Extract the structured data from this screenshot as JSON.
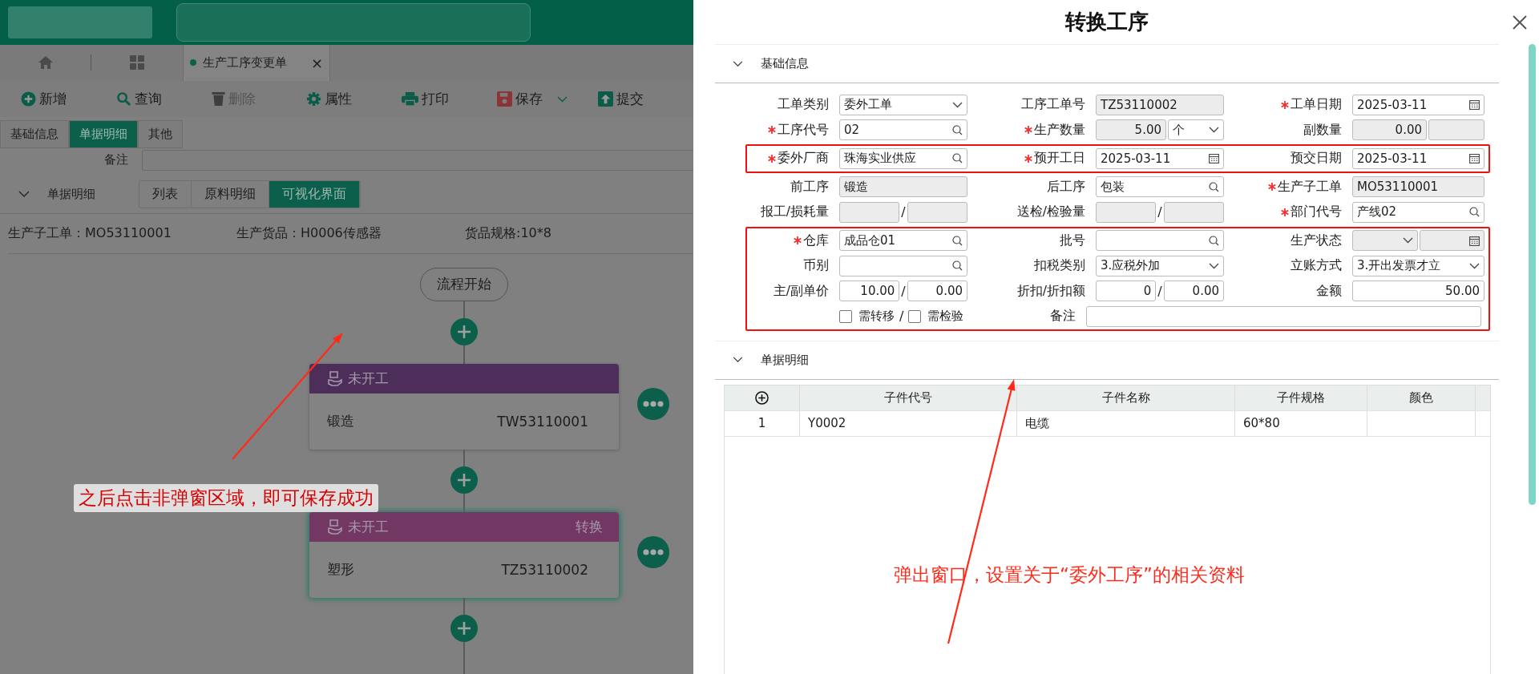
{
  "nav": {
    "tabs": [
      {
        "label": "生产工序变更单",
        "close": "×",
        "selected": true
      }
    ]
  },
  "toolbar": [
    {
      "kind": "add",
      "label": "新增",
      "disabled": false,
      "dropdown": false
    },
    {
      "kind": "search",
      "label": "查询",
      "disabled": false,
      "dropdown": false
    },
    {
      "kind": "delete",
      "label": "删除",
      "disabled": true,
      "dropdown": false
    },
    {
      "kind": "settings",
      "label": "属性",
      "disabled": false,
      "dropdown": false
    },
    {
      "kind": "print",
      "label": "打印",
      "disabled": false,
      "dropdown": false
    },
    {
      "kind": "save",
      "label": "保存",
      "disabled": false,
      "dropdown": true
    },
    {
      "kind": "submit",
      "label": "提交",
      "disabled": false,
      "dropdown": false
    }
  ],
  "form_tabs": [
    {
      "label": "基础信息",
      "selected": false
    },
    {
      "label": "单据明细",
      "selected": true
    },
    {
      "label": "其他",
      "selected": false
    }
  ],
  "remark": {
    "label": "备注"
  },
  "detail": {
    "title": "单据明细",
    "expanded": true,
    "views": [
      {
        "label": "列表",
        "selected": false
      },
      {
        "label": "原料明细",
        "selected": false
      },
      {
        "label": "可视化界面",
        "selected": true
      }
    ]
  },
  "info": [
    "生产子工单：MO53110001",
    "生产货品：H0006传感器",
    "货品规格:10*8"
  ],
  "flow": {
    "start": "流程开始",
    "nodes": [
      {
        "status": "未开工",
        "name": "锻造",
        "code": "TW53110001",
        "color": "#4d2d5a",
        "selected": false
      },
      {
        "status": "未开工",
        "action": "转换",
        "name": "塑形",
        "code": "TZ53110002",
        "color": "#733763",
        "selected": true
      }
    ]
  },
  "annotations": [
    "之后点击非弹窗区域，即可保存成功",
    "弹出窗口，设置关于“委外工序”的相关资料"
  ],
  "dialog": {
    "title": "转换工序",
    "basic": {
      "title": "基础信息",
      "expanded": true,
      "groups": [
        {
          "highlighted": false,
          "rows": [
            [
              {
                "label": "工单类别",
                "required": false,
                "kind": "single",
                "inputs": [
                  {
                    "kind": "select",
                    "value": "委外工单",
                    "readonly": false
                  }
                ]
              },
              {
                "label": "工序工单号",
                "required": false,
                "kind": "single",
                "inputs": [
                  {
                    "kind": "text",
                    "value": "TZ53110002",
                    "readonly": true
                  }
                ]
              },
              {
                "label": "工单日期",
                "required": true,
                "kind": "single",
                "inputs": [
                  {
                    "kind": "date",
                    "value": "2025-03-11",
                    "readonly": false
                  }
                ]
              }
            ],
            [
              {
                "label": "工序代号",
                "required": true,
                "kind": "single",
                "inputs": [
                  {
                    "kind": "lookup",
                    "value": "02",
                    "readonly": false
                  }
                ]
              },
              {
                "label": "生产数量",
                "required": true,
                "kind": "split",
                "inputs": [
                  {
                    "kind": "number",
                    "value": "5.00",
                    "readonly": true
                  },
                  {
                    "kind": "select",
                    "value": "个",
                    "readonly": false
                  }
                ]
              },
              {
                "label": "副数量",
                "required": false,
                "kind": "split",
                "inputs": [
                  {
                    "kind": "number",
                    "value": "0.00",
                    "readonly": true
                  },
                  {
                    "kind": "text",
                    "readonly": true
                  }
                ]
              }
            ]
          ]
        },
        {
          "highlighted": true,
          "rows": [
            [
              {
                "label": "委外厂商",
                "required": true,
                "kind": "single",
                "inputs": [
                  {
                    "kind": "lookup",
                    "value": "珠海实业供应",
                    "readonly": false
                  }
                ]
              },
              {
                "label": "预开工日",
                "required": true,
                "kind": "single",
                "inputs": [
                  {
                    "kind": "date",
                    "value": "2025-03-11",
                    "readonly": false
                  }
                ]
              },
              {
                "label": "预交日期",
                "required": false,
                "kind": "single",
                "inputs": [
                  {
                    "kind": "date",
                    "value": "2025-03-11",
                    "readonly": false
                  }
                ]
              }
            ]
          ]
        },
        {
          "highlighted": false,
          "rows": [
            [
              {
                "label": "前工序",
                "required": false,
                "kind": "single",
                "inputs": [
                  {
                    "kind": "text",
                    "value": "锻造",
                    "readonly": true
                  }
                ]
              },
              {
                "label": "后工序",
                "required": false,
                "kind": "single",
                "inputs": [
                  {
                    "kind": "lookup",
                    "value": "包装",
                    "readonly": false
                  }
                ]
              },
              {
                "label": "生产子工单",
                "required": true,
                "kind": "single",
                "inputs": [
                  {
                    "kind": "text",
                    "value": "MO53110001",
                    "readonly": true
                  }
                ]
              }
            ],
            [
              {
                "label": "报工/损耗量",
                "required": false,
                "kind": "pair",
                "separator": "/",
                "inputs": [
                  {
                    "kind": "text",
                    "readonly": true
                  },
                  {
                    "kind": "text",
                    "readonly": true
                  }
                ]
              },
              {
                "label": "送检/检验量",
                "required": false,
                "kind": "pair",
                "separator": "/",
                "inputs": [
                  {
                    "kind": "text",
                    "readonly": true
                  },
                  {
                    "kind": "text",
                    "readonly": true
                  }
                ]
              },
              {
                "label": "部门代号",
                "required": true,
                "kind": "single",
                "inputs": [
                  {
                    "kind": "lookup",
                    "value": "产线02",
                    "readonly": false
                  }
                ]
              }
            ]
          ]
        },
        {
          "highlighted": true,
          "rows": [
            [
              {
                "label": "仓库",
                "required": true,
                "kind": "single",
                "inputs": [
                  {
                    "kind": "lookup",
                    "value": "成品仓01",
                    "readonly": false
                  }
                ]
              },
              {
                "label": "批号",
                "required": false,
                "kind": "single",
                "inputs": [
                  {
                    "kind": "lookup",
                    "readonly": false
                  }
                ]
              },
              {
                "label": "生产状态",
                "required": false,
                "kind": "pair",
                "inputs": [
                  {
                    "kind": "select",
                    "readonly": true
                  },
                  {
                    "kind": "date",
                    "readonly": true
                  }
                ]
              }
            ],
            [
              {
                "label": "币别",
                "required": false,
                "kind": "single",
                "inputs": [
                  {
                    "kind": "lookup",
                    "readonly": false
                  }
                ]
              },
              {
                "label": "扣税类别",
                "required": false,
                "kind": "single",
                "inputs": [
                  {
                    "kind": "select",
                    "value": "3.应税外加",
                    "readonly": false
                  }
                ]
              },
              {
                "label": "立账方式",
                "required": false,
                "kind": "single",
                "inputs": [
                  {
                    "kind": "select",
                    "value": "3.开出发票才立",
                    "readonly": false
                  }
                ]
              }
            ],
            [
              {
                "label": "主/副单价",
                "required": false,
                "kind": "pair",
                "separator": "/",
                "inputs": [
                  {
                    "kind": "number",
                    "value": "10.00",
                    "readonly": false
                  },
                  {
                    "kind": "number",
                    "value": "0.00",
                    "readonly": false
                  }
                ]
              },
              {
                "label": "折扣/折扣额",
                "required": false,
                "kind": "pair",
                "separator": "/",
                "inputs": [
                  {
                    "kind": "number",
                    "value": "0",
                    "readonly": false
                  },
                  {
                    "kind": "number",
                    "value": "0.00",
                    "readonly": false
                  }
                ]
              },
              {
                "label": "金额",
                "required": false,
                "kind": "single",
                "inputs": [
                  {
                    "kind": "number",
                    "value": "50.00",
                    "readonly": false
                  }
                ]
              }
            ],
            [
              {
                "kind": "checks",
                "separator": "/",
                "checks": [
                  {
                    "label": "需转移",
                    "checked": false
                  },
                  {
                    "label": "需检验",
                    "checked": false
                  }
                ]
              },
              {
                "label": "备注",
                "required": false,
                "kind": "wide",
                "inputs": [
                  {
                    "kind": "text",
                    "readonly": false
                  }
                ]
              }
            ]
          ]
        }
      ]
    },
    "detail": {
      "title": "单据明细",
      "expanded": true,
      "table": {
        "columns": [
          "子件代号",
          "子件名称",
          "子件规格",
          "颜色"
        ],
        "rows": [
          {
            "no": "1",
            "cells": [
              "Y0002",
              "电缆",
              "60*80"
            ]
          }
        ]
      }
    }
  }
}
